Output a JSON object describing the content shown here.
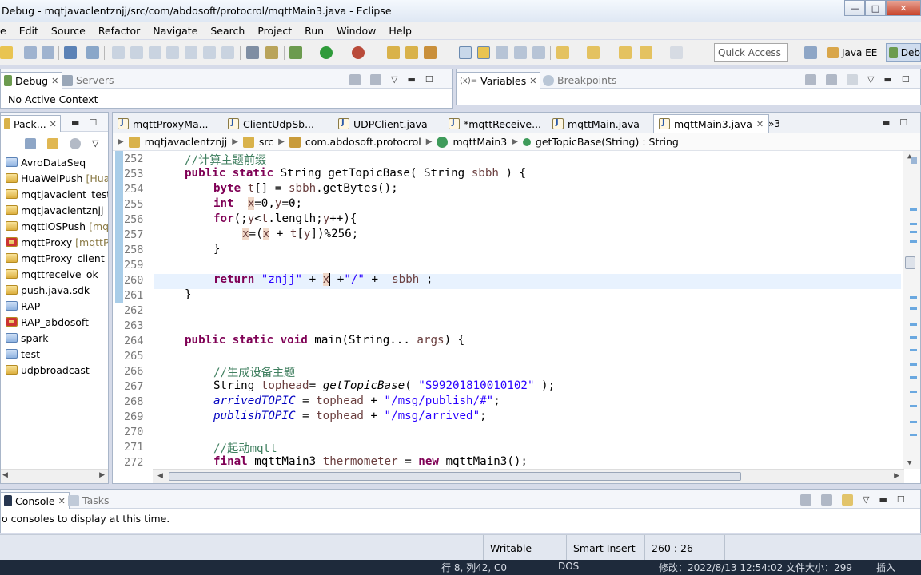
{
  "window": {
    "title": "Debug - mqtjavaclentznjj/src/com/abdosoft/protocrol/mqttMain3.java - Eclipse",
    "minimize_glyph": "—",
    "maximize_glyph": "□",
    "close_glyph": "✕"
  },
  "menu": [
    "e",
    "Edit",
    "Source",
    "Refactor",
    "Navigate",
    "Search",
    "Project",
    "Run",
    "Window",
    "Help"
  ],
  "toolbar": {
    "quick_access_placeholder": "Quick Access",
    "perspective_java_ee": "Java EE",
    "perspective_debug": "Deb"
  },
  "debug_view": {
    "tabs": [
      "Debug",
      "Servers"
    ],
    "message": "No Active Context"
  },
  "variables_view": {
    "tabs": [
      "Variables",
      "Breakpoints"
    ]
  },
  "package_explorer": {
    "tab": "Pack...",
    "items": [
      {
        "name": "AvroDataSeq",
        "decor": ""
      },
      {
        "name": "HuaWeiPush",
        "decor": "[Hua"
      },
      {
        "name": "mqtjavaclent_test",
        "decor": ""
      },
      {
        "name": "mqtjavaclentznjj",
        "decor": ""
      },
      {
        "name": "mqttIOSPush",
        "decor": "[mq"
      },
      {
        "name": "mqttProxy",
        "decor": "[mqttPr"
      },
      {
        "name": "mqttProxy_client_t",
        "decor": ""
      },
      {
        "name": "mqttreceive_ok",
        "decor": ""
      },
      {
        "name": "push.java.sdk",
        "decor": ""
      },
      {
        "name": "RAP",
        "decor": ""
      },
      {
        "name": "RAP_abdosoft",
        "decor": ""
      },
      {
        "name": "spark",
        "decor": ""
      },
      {
        "name": "test",
        "decor": ""
      },
      {
        "name": "udpbroadcast",
        "decor": ""
      }
    ]
  },
  "editor": {
    "tabs": [
      "mqttProxyMa...",
      "ClientUdpSb...",
      "UDPClient.java",
      "*mqttReceive...",
      "mqttMain.java",
      "mqttMain3.java"
    ],
    "overflow_count": "»3",
    "breadcrumb": [
      "mqtjavaclentznjj",
      "src",
      "com.abdosoft.protocrol",
      "mqttMain3",
      "getTopicBase(String) : String"
    ],
    "line_numbers": [
      "252",
      "253",
      "254",
      "255",
      "256",
      "257",
      "258",
      "259",
      "260",
      "261",
      "262",
      "263",
      "264",
      "265",
      "266",
      "267",
      "268",
      "269",
      "270",
      "271",
      "272"
    ],
    "code_text": {
      "l252": "//计算主题前缀",
      "l253a": "public static",
      "l253b": " String getTopicBase( String ",
      "l253c": "sbbh",
      "l253d": " ) {",
      "l254a": "byte",
      "l254b": " ",
      "l254c": "t",
      "l254d": "[] = ",
      "l254e": "sbbh",
      "l254f": ".getBytes();",
      "l255a": "int",
      "l255b": "  ",
      "l255c": "x",
      "l255d": "=0,",
      "l255e": "y",
      "l255f": "=0;",
      "l256a": "for",
      "l256b": "(;",
      "l256c": "y",
      "l256d": "<",
      "l256e": "t",
      "l256f": ".length;",
      "l256g": "y",
      "l256h": "++){",
      "l257a": "x",
      "l257b": "=(",
      "l257c": "x",
      "l257d": " + ",
      "l257e": "t",
      "l257f": "[",
      "l257g": "y",
      "l257h": "])%256;",
      "l258": "}",
      "l260a": "return",
      "l260b": " ",
      "l260c": "\"znjj\"",
      "l260d": " + ",
      "l260e": "x",
      "l260f": " +",
      "l260g": "\"/\"",
      "l260h": " +  ",
      "l260i": "sbbh",
      "l260j": " ;",
      "l261": "}",
      "l264a": "public static void",
      "l264b": " main(String... ",
      "l264c": "args",
      "l264d": ") {",
      "l266": "//生成设备主题",
      "l267a": "String ",
      "l267b": "tophead",
      "l267c": "= ",
      "l267d": "getTopicBase",
      "l267e": "( ",
      "l267f": "\"S99201810010102\"",
      "l267g": " );",
      "l268a": "arrivedTOPIC",
      "l268b": " = ",
      "l268c": "tophead",
      "l268d": " + ",
      "l268e": "\"/msg/publish/#\"",
      "l268f": ";",
      "l269a": "publishTOPIC",
      "l269b": " = ",
      "l269c": "tophead",
      "l269d": " + ",
      "l269e": "\"/msg/arrived\"",
      "l269f": ";",
      "l271": "//起动mqtt",
      "l272a": "final",
      "l272b": " mqttMain3 ",
      "l272c": "thermometer",
      "l272d": " = ",
      "l272e": "new",
      "l272f": " mqttMain3();"
    }
  },
  "console": {
    "tabs": [
      "Console",
      "Tasks"
    ],
    "message": "o consoles to display at this time."
  },
  "status_bar": {
    "writable": "Writable",
    "insert_mode": "Smart Insert",
    "position": "260 : 26"
  },
  "taskbar": {
    "position": "行 8, 列42, C0",
    "encoding": "DOS",
    "modified": "修改：2022/8/13 12:54:02  文件大小：299",
    "mode": "插入"
  },
  "colors": {
    "keyword": "#7f0055",
    "comment": "#3f7f5f",
    "string": "#2a00ff",
    "field": "#0000c0"
  }
}
